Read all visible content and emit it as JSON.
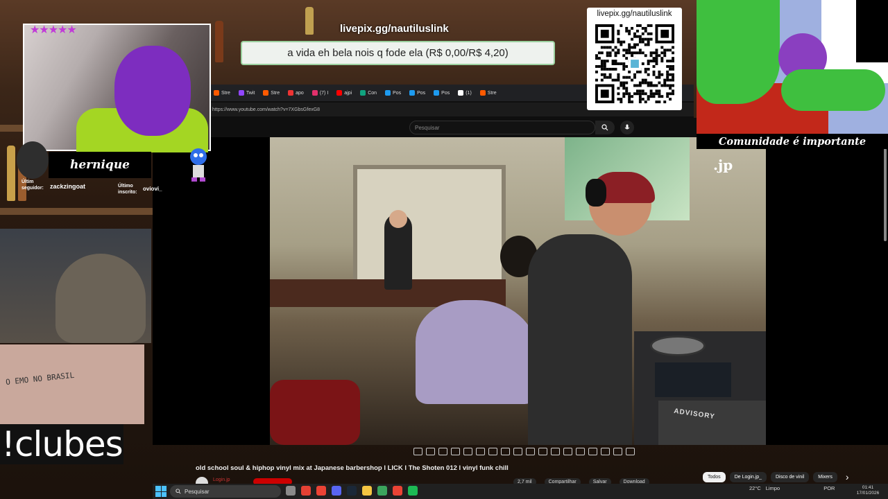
{
  "overlays": {
    "livepix_top": "livepix.gg/nautiluslink",
    "donation_text": "a vida eh bela nois q fode ela (R$ 0,00/R$ 4,20)",
    "qr_label": "livepix.gg/nautiluslink",
    "streamer_name": "hernique",
    "last_follower_label": "Últim seguidor:",
    "last_follower_name": "zackzingoat",
    "last_sub_label": "Último inscrito:",
    "last_sub_name": "oviovi_",
    "command_text": "!clubes",
    "cartoon_caption": "Comunidade é importante",
    "graffiti_text": "O EMO NO BRASIL",
    "stars": "★★★★★"
  },
  "browser": {
    "tabs": [
      {
        "label": "Stre",
        "color": "#ff5a00"
      },
      {
        "label": "Twit",
        "color": "#9146ff"
      },
      {
        "label": "Stre",
        "color": "#ff5a00"
      },
      {
        "label": "apo",
        "color": "#e33"
      },
      {
        "label": "(7) I",
        "color": "#e1306c"
      },
      {
        "label": "ajpi",
        "color": "#ff0000"
      },
      {
        "label": "Con",
        "color": "#10a37f"
      },
      {
        "label": "Pos",
        "color": "#1d9bf0"
      },
      {
        "label": "Pos",
        "color": "#1d9bf0"
      },
      {
        "label": "Pos",
        "color": "#1d9bf0"
      },
      {
        "label": "(1)",
        "color": "#ffffff"
      },
      {
        "label": "Stre",
        "color": "#ff5a00"
      }
    ],
    "url": "https://www.youtube.com/watch?v=7XGbsGfexG8"
  },
  "youtube": {
    "search_placeholder": "Pesquisar",
    "video_watermark": ".jp",
    "case_text": "ADVISORY",
    "video_title": "old school soul & hiphop vinyl mix at Japanese barbershop l LICK l The Shoten 012 l vinyl funk chill",
    "channel_name": "Login.jp",
    "actions": [
      "2,7 mil",
      "Compartilhar",
      "Salvar",
      "Download"
    ],
    "chips": [
      {
        "label": "Todos",
        "active": true
      },
      {
        "label": "De Login.jp_",
        "active": false
      },
      {
        "label": "Disco de vinil",
        "active": false
      },
      {
        "label": "Mixers",
        "active": false
      }
    ]
  },
  "taskbar": {
    "search_placeholder": "Pesquisar",
    "weather": "22°C",
    "weather_desc": "Limpo",
    "lang": "POR",
    "time": "01:41",
    "date": "17/01/2026",
    "apps": [
      "#8a8a8a",
      "#e44134",
      "#ea4335",
      "#5865f2",
      "#1b2838",
      "#f4c542",
      "#3ba55d",
      "#ea4335",
      "#1db954"
    ]
  }
}
